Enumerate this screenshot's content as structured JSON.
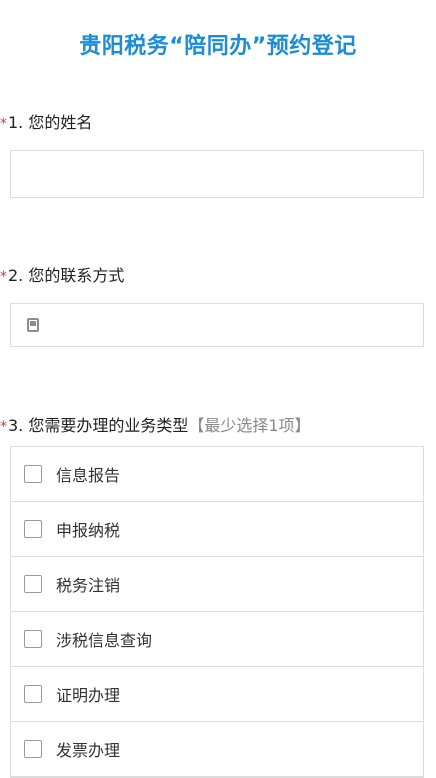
{
  "page": {
    "title": "贵阳税务“陪同办”预约登记"
  },
  "questions": {
    "q1": {
      "required_mark": "*",
      "label": "1. 您的姓名",
      "value": ""
    },
    "q2": {
      "required_mark": "*",
      "label": "2. 您的联系方式",
      "icon": "phone-icon",
      "value": ""
    },
    "q3": {
      "required_mark": "*",
      "label": "3. 您需要办理的业务类型",
      "hint": "【最少选择1项】",
      "options": [
        {
          "label": "信息报告",
          "checked": false
        },
        {
          "label": "申报纳税",
          "checked": false
        },
        {
          "label": "税务注销",
          "checked": false
        },
        {
          "label": "涉税信息查询",
          "checked": false
        },
        {
          "label": "证明办理",
          "checked": false
        },
        {
          "label": "发票办理",
          "checked": false
        }
      ]
    }
  },
  "colors": {
    "title": "#1a8cd8",
    "required_mark": "#d43c3c",
    "hint": "#8a8a8a",
    "border": "#dcdcdc"
  }
}
